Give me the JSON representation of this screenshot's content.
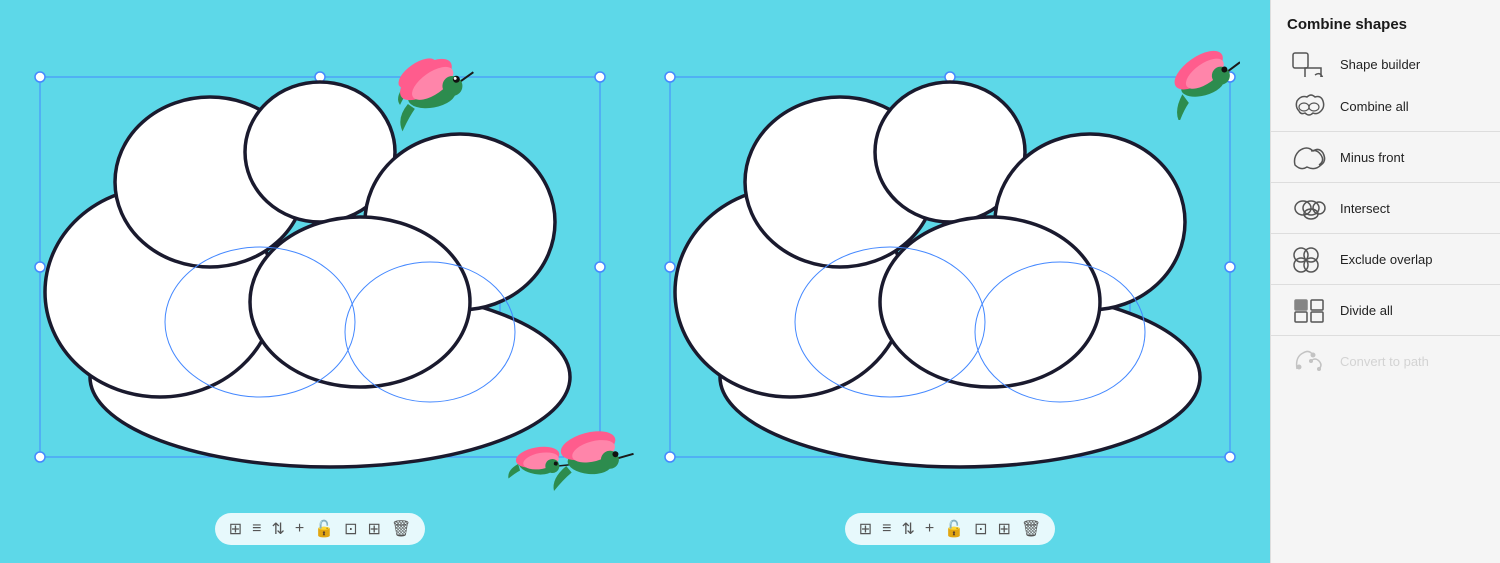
{
  "panel": {
    "title": "Combine shapes",
    "items": [
      {
        "id": "shape-builder",
        "label": "Shape builder",
        "icon": "shape-builder",
        "active": false,
        "disabled": false
      },
      {
        "id": "combine-all",
        "label": "Combine all",
        "icon": "combine-all",
        "active": false,
        "disabled": false
      },
      {
        "id": "minus-front",
        "label": "Minus front",
        "icon": "minus-front",
        "active": false,
        "disabled": false
      },
      {
        "id": "intersect",
        "label": "Intersect",
        "icon": "intersect",
        "active": false,
        "disabled": false
      },
      {
        "id": "exclude-overlap",
        "label": "Exclude overlap",
        "icon": "exclude-overlap",
        "active": false,
        "disabled": false
      },
      {
        "id": "divide-all",
        "label": "Divide all",
        "icon": "divide-all",
        "active": false,
        "disabled": false
      },
      {
        "id": "convert-to-path",
        "label": "Convert to path",
        "icon": "convert-to-path",
        "active": false,
        "disabled": true
      }
    ]
  },
  "toolbar": {
    "buttons": [
      "⊞",
      "≡",
      "⇅",
      "+",
      "🔓",
      "⊡",
      "⊞",
      "🗑"
    ]
  }
}
